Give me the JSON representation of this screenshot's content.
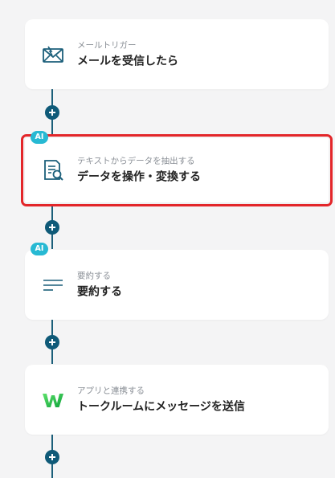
{
  "colors": {
    "background": "#f4f4f5",
    "connector": "#1b5f7a",
    "plus_button": "#0f5a78",
    "ai_badge": "#27b9d3",
    "selection_outline": "#e3262a",
    "wrike_green": "#13c24b"
  },
  "steps": [
    {
      "icon": "mail-icon",
      "subtitle": "メールトリガー",
      "title": "メールを受信したら",
      "ai": false,
      "selected": false
    },
    {
      "icon": "document-search-icon",
      "subtitle": "テキストからデータを抽出する",
      "title": "データを操作・変換する",
      "ai": true,
      "ai_label": "AI",
      "selected": true
    },
    {
      "icon": "summary-lines-icon",
      "subtitle": "要約する",
      "title": "要約する",
      "ai": true,
      "ai_label": "AI",
      "selected": false
    },
    {
      "icon": "wrike-logo-icon",
      "subtitle": "アプリと連携する",
      "title": "トークルームにメッセージを送信",
      "ai": false,
      "selected": false
    }
  ]
}
